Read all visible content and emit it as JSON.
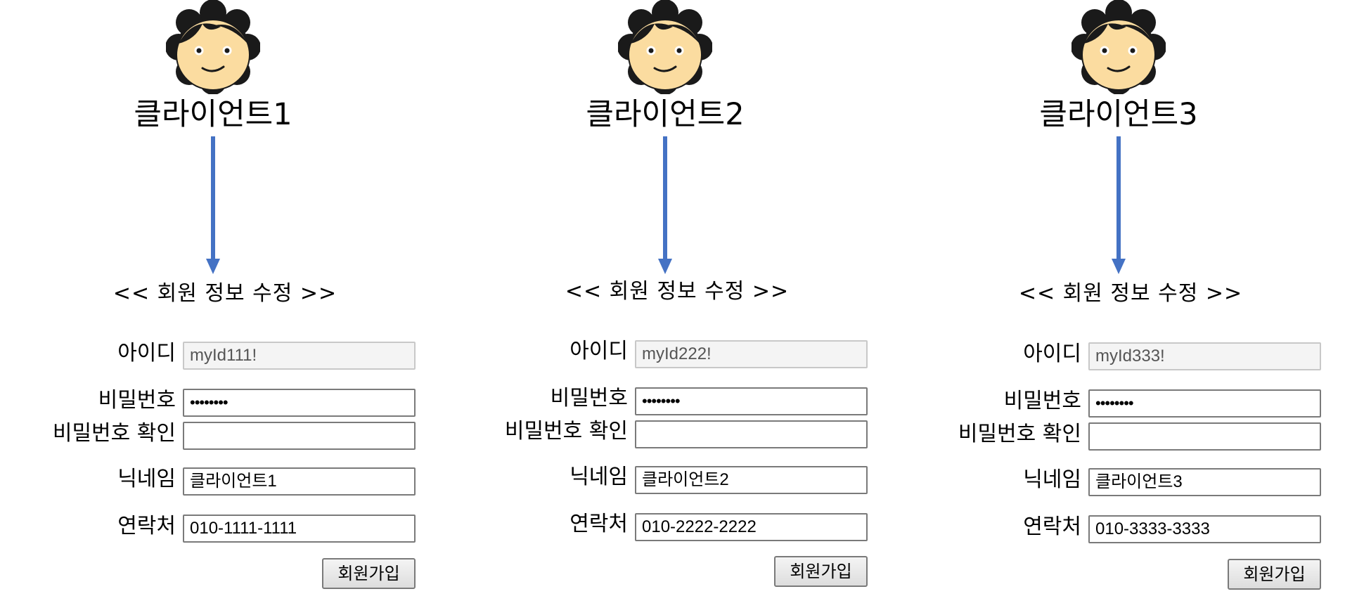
{
  "colors": {
    "arrow": "#4472c4",
    "avatar_hair": "#1a1a1a",
    "avatar_face": "#fbdca0"
  },
  "clients": [
    {
      "label": "클라이언트1",
      "avatar_icon": "person-avatar-icon",
      "form": {
        "title": "<< 회원 정보 수정 >>",
        "id_label": "아이디",
        "id_value": "myId111!",
        "password_label": "비밀번호",
        "password_value": "••••••••",
        "password_confirm_label": "비밀번호 확인",
        "password_confirm_value": "",
        "nickname_label": "닉네임",
        "nickname_value": "클라이언트1",
        "phone_label": "연락처",
        "phone_value": "010-1111-1111",
        "submit_label": "회원가입"
      }
    },
    {
      "label": "클라이언트2",
      "avatar_icon": "person-avatar-icon",
      "form": {
        "title": "<< 회원 정보 수정 >>",
        "id_label": "아이디",
        "id_value": "myId222!",
        "password_label": "비밀번호",
        "password_value": "••••••••",
        "password_confirm_label": "비밀번호 확인",
        "password_confirm_value": "",
        "nickname_label": "닉네임",
        "nickname_value": "클라이언트2",
        "phone_label": "연락처",
        "phone_value": "010-2222-2222",
        "submit_label": "회원가입"
      }
    },
    {
      "label": "클라이언트3",
      "avatar_icon": "person-avatar-icon",
      "form": {
        "title": "<< 회원 정보 수정 >>",
        "id_label": "아이디",
        "id_value": "myId333!",
        "password_label": "비밀번호",
        "password_value": "••••••••",
        "password_confirm_label": "비밀번호 확인",
        "password_confirm_value": "",
        "nickname_label": "닉네임",
        "nickname_value": "클라이언트3",
        "phone_label": "연락처",
        "phone_value": "010-3333-3333",
        "submit_label": "회원가입"
      }
    }
  ]
}
